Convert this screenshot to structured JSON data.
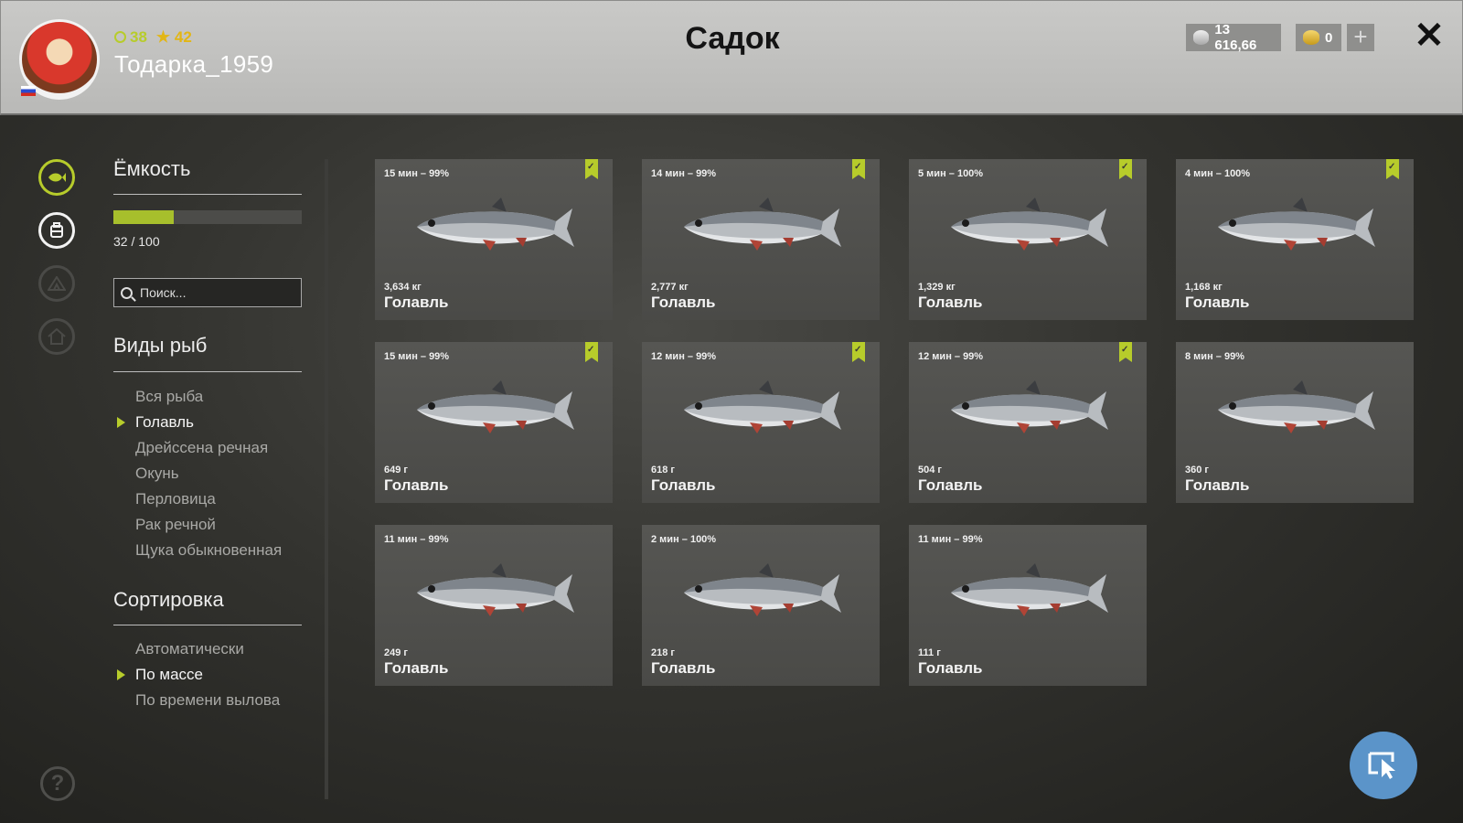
{
  "header": {
    "title": "Садок",
    "player_name": "Тодарка_1959",
    "level": "38",
    "rank": "42",
    "silver": "13 616,66",
    "gold": "0",
    "plus_label": "+",
    "close_label": "✕",
    "help_label": "?"
  },
  "capacity": {
    "title": "Ёмкость",
    "text": "32 / 100",
    "value": 32,
    "max": 100
  },
  "search": {
    "placeholder": "Поиск..."
  },
  "species": {
    "title": "Виды рыб",
    "items": [
      "Вся рыба",
      "Голавль",
      "Дрейссена речная",
      "Окунь",
      "Перловица",
      "Рак речной",
      "Щука обыкновенная"
    ],
    "selected": "Голавль"
  },
  "sorting": {
    "title": "Сортировка",
    "items": [
      "Автоматически",
      "По массе",
      "По времени вылова"
    ],
    "selected": "По массе"
  },
  "fish": [
    {
      "time": "15 мин – 99%",
      "weight": "3,634 кг",
      "name": "Голавль",
      "marked": true
    },
    {
      "time": "14 мин – 99%",
      "weight": "2,777 кг",
      "name": "Голавль",
      "marked": true
    },
    {
      "time": "5 мин – 100%",
      "weight": "1,329 кг",
      "name": "Голавль",
      "marked": true
    },
    {
      "time": "4 мин – 100%",
      "weight": "1,168 кг",
      "name": "Голавль",
      "marked": true
    },
    {
      "time": "15 мин – 99%",
      "weight": "649 г",
      "name": "Голавль",
      "marked": true
    },
    {
      "time": "12 мин – 99%",
      "weight": "618 г",
      "name": "Голавль",
      "marked": true
    },
    {
      "time": "12 мин – 99%",
      "weight": "504 г",
      "name": "Голавль",
      "marked": true
    },
    {
      "time": "8 мин – 99%",
      "weight": "360 г",
      "name": "Голавль",
      "marked": false
    },
    {
      "time": "11 мин – 99%",
      "weight": "249 г",
      "name": "Голавль",
      "marked": false
    },
    {
      "time": "2 мин – 100%",
      "weight": "218 г",
      "name": "Голавль",
      "marked": false
    },
    {
      "time": "11 мин – 99%",
      "weight": "111 г",
      "name": "Голавль",
      "marked": false
    }
  ],
  "colors": {
    "accent": "#b7cc2b",
    "action_button": "#5b94c9"
  }
}
